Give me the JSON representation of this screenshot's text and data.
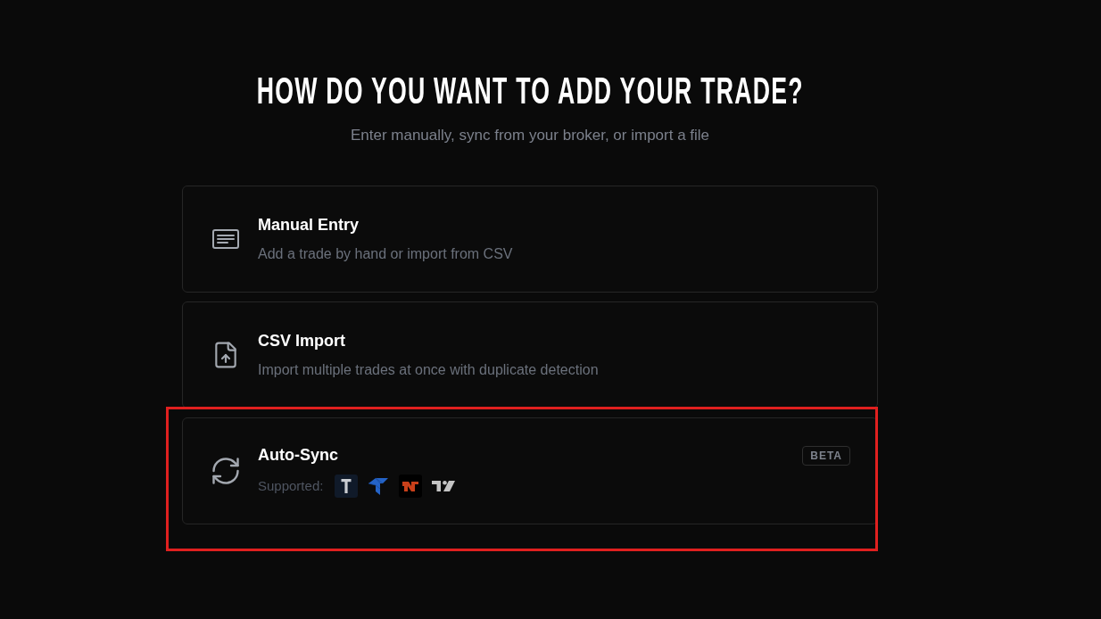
{
  "heading": {
    "title": "HOW DO YOU WANT TO ADD YOUR TRADE?",
    "subtitle": "Enter manually, sync from your broker, or import a file"
  },
  "options": [
    {
      "kind": "manual",
      "title": "Manual Entry",
      "description": "Add a trade by hand or import from CSV",
      "highlighted": false
    },
    {
      "kind": "csv",
      "title": "CSV Import",
      "description": "Import multiple trades at once with duplicate detection",
      "highlighted": false
    },
    {
      "kind": "sync",
      "title": "Auto-Sync",
      "supported_label": "Supported:",
      "badge": "BETA",
      "highlighted": true
    }
  ]
}
